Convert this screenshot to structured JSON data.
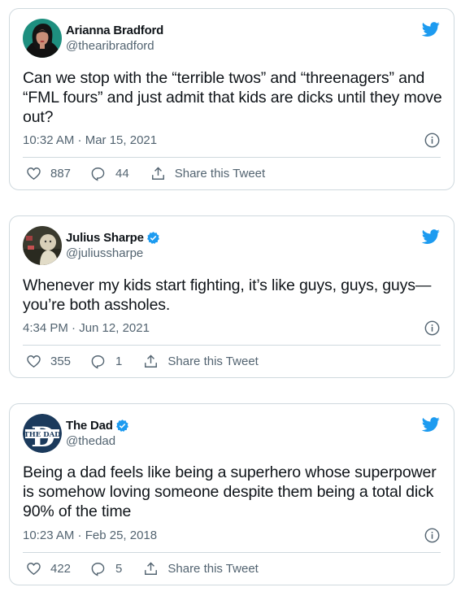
{
  "tweets": [
    {
      "name": "Arianna Bradford",
      "handle": "@thearibradford",
      "verified": false,
      "avatar_icon": "woman-portrait",
      "text": "Can we stop with the “terrible twos” and “threenagers” and “FML fours” and just admit that kids are dicks until they move out?",
      "timestamp": "10:32 AM · Mar 15, 2021",
      "likes": "887",
      "replies": "44",
      "share_label": "Share this Tweet"
    },
    {
      "name": "Julius Sharpe",
      "handle": "@juliussharpe",
      "verified": true,
      "avatar_icon": "man-portrait",
      "text": "Whenever my kids start fighting, it’s like guys, guys, guys— you’re both assholes.",
      "timestamp": "4:34 PM · Jun 12, 2021",
      "likes": "355",
      "replies": "1",
      "share_label": "Share this Tweet"
    },
    {
      "name": "The Dad",
      "handle": "@thedad",
      "verified": true,
      "avatar_icon": "the-dad-logo",
      "avatar_logo_text": "THE DAD",
      "text": "Being a dad feels like being a superhero whose superpower is somehow loving someone despite them being a total dick 90% of the time",
      "timestamp": "10:23 AM · Feb 25, 2018",
      "likes": "422",
      "replies": "5",
      "share_label": "Share this Tweet"
    }
  ],
  "colors": {
    "twitter_blue": "#1d9bf0",
    "text": "#0f1419",
    "secondary_text": "#536471",
    "border": "#cfd9de"
  }
}
